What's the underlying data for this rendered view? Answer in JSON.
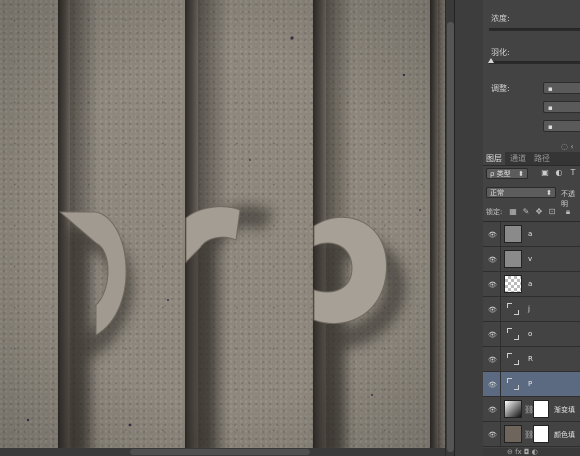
{
  "canvas": {
    "letters": [
      "p",
      "r",
      "p"
    ]
  },
  "properties_panel": {
    "density_label": "浓度:",
    "feather_label": "羽化:",
    "adjust_label": "调整:",
    "bottom_icons": "◌ ‹"
  },
  "layers_panel": {
    "tabs": [
      "图层",
      "通道",
      "路径"
    ],
    "active_tab": "图层",
    "filter": {
      "kind_value": "ρ 类型",
      "icons": [
        "image-filter-icon",
        "adjustment-filter-icon",
        "type-filter-icon"
      ]
    },
    "blend_mode": "正常",
    "opacity_label": "不透明",
    "lock_label": "锁定:",
    "layers": [
      {
        "name": "a",
        "thumb": "gray",
        "visible": true,
        "selected": false
      },
      {
        "name": "v",
        "thumb": "gray",
        "visible": true,
        "selected": false
      },
      {
        "name": "a",
        "thumb": "checker",
        "visible": true,
        "selected": false
      },
      {
        "name": "j",
        "thumb": "smart",
        "visible": true,
        "selected": false
      },
      {
        "name": "o",
        "thumb": "smart",
        "visible": true,
        "selected": false
      },
      {
        "name": "R",
        "thumb": "smart",
        "visible": true,
        "selected": false
      },
      {
        "name": "P",
        "thumb": "smart",
        "visible": true,
        "selected": true
      },
      {
        "name": "渐变填",
        "thumb": "gradient",
        "visible": true,
        "selected": false,
        "mask": true
      },
      {
        "name": "颜色填",
        "thumb": "fill",
        "visible": true,
        "selected": false,
        "mask": true
      }
    ],
    "footer_icons": "⊖ fx ◘ ◐"
  },
  "colors": {
    "panel_bg": "#434343",
    "selected_layer": "#5b6a80",
    "canvas_stone": "#8d877d"
  }
}
